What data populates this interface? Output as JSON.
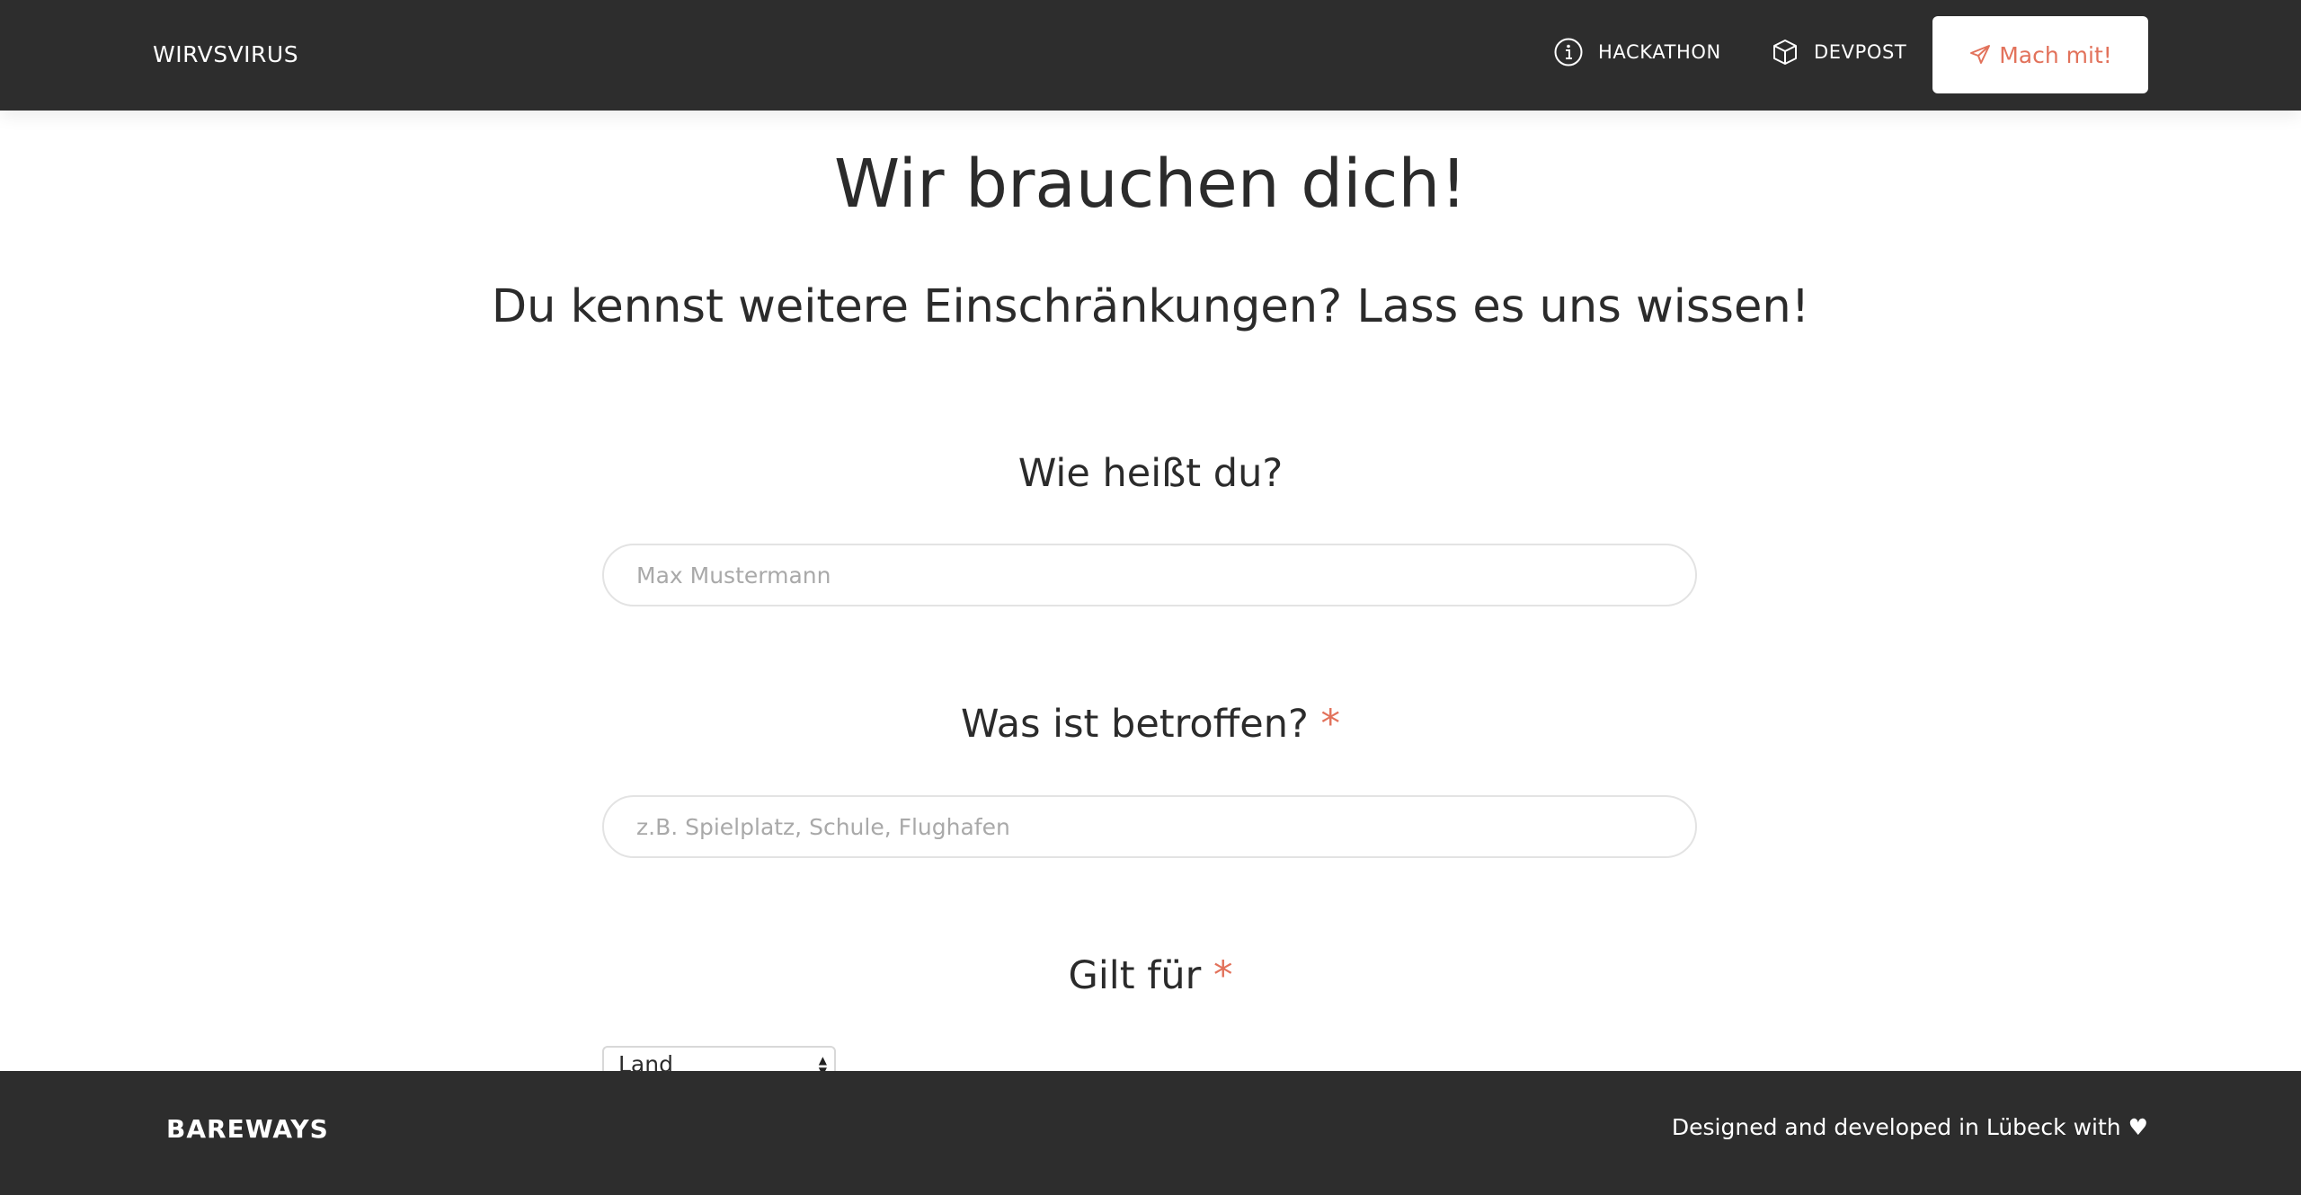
{
  "header": {
    "brand": "WIRVSVIRUS",
    "nav": [
      {
        "label": "HACKATHON",
        "icon": "info-icon"
      },
      {
        "label": "DEVPOST",
        "icon": "cube-icon"
      }
    ],
    "cta": {
      "label": "Mach mit!",
      "icon": "paper-plane-icon"
    }
  },
  "main": {
    "title": "Wir brauchen dich!",
    "subtitle": "Du kennst weitere Einschränkungen? Lass es uns wissen!",
    "questions": [
      {
        "label": "Wie heißt du?",
        "required": "",
        "placeholder": "Max Mustermann"
      },
      {
        "label": "Was ist betroffen?",
        "required": "*",
        "placeholder": "z.B. Spielplatz, Schule, Flughafen"
      },
      {
        "label": "Gilt für",
        "required": "*"
      }
    ],
    "scope_select": {
      "value": "Land"
    }
  },
  "footer": {
    "logo": "BAREWAYS",
    "credit": "Designed and developed in Lübeck with ♥"
  },
  "colors": {
    "header_bg": "#2d2d2d",
    "accent": "#e2725b",
    "text": "#2b2b2b",
    "input_border": "#e3e3e3",
    "placeholder": "#a9a9a9"
  }
}
